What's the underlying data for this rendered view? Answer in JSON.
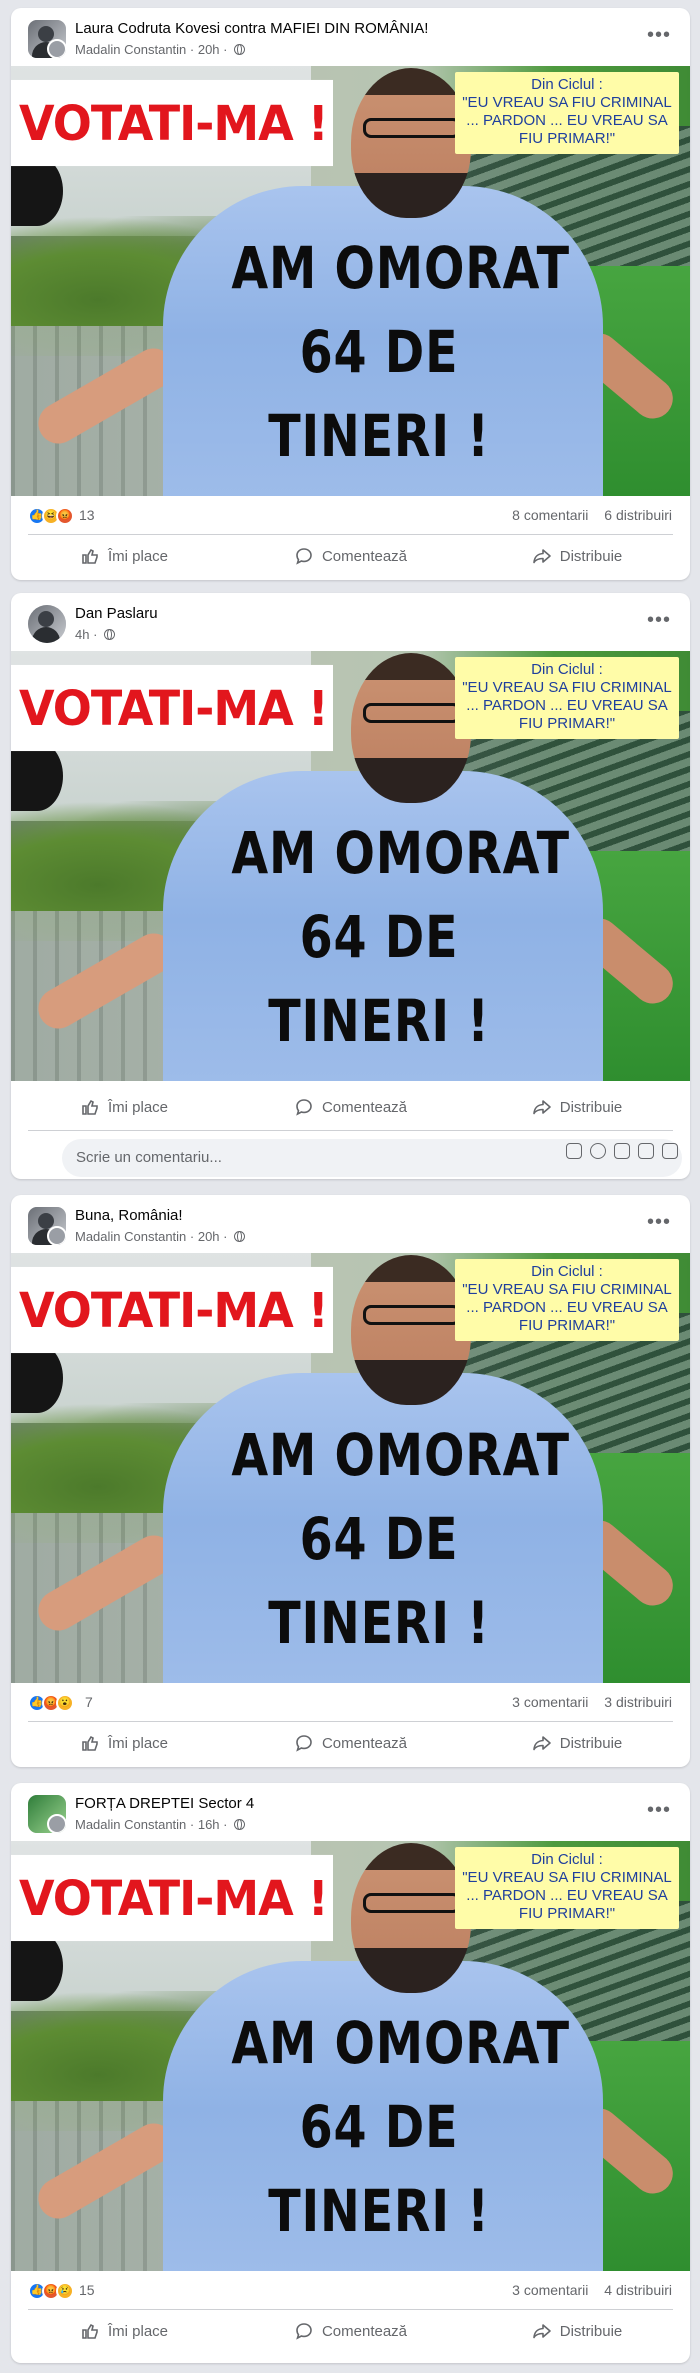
{
  "posts": [
    {
      "title": "Laura Codruta Kovesi contra MAFIEI DIN ROMÂNIA!",
      "meta": "Madalin Constantin · 20h ·",
      "image": {
        "banner": "VOTATI-MA !",
        "cycle_label": "Din Ciclul :",
        "cycle_text": "\"EU VREAU SA FIU CRIMINAL ... PARDON ... EU VREAU SA FIU PRIMAR!\"",
        "shirt_lines": [
          "AM OMORAT",
          "64 DE",
          "TINERI !"
        ]
      },
      "reactions_count": "13",
      "comments": "8 comentarii",
      "shares": "6 distribuiri"
    },
    {
      "title": "Dan Paslaru",
      "meta": "4h ·",
      "image": {
        "banner": "VOTATI-MA !",
        "cycle_label": "Din Ciclul :",
        "cycle_text": "\"EU VREAU SA FIU CRIMINAL ... PARDON ... EU VREAU SA FIU PRIMAR!\"",
        "shirt_lines": [
          "AM OMORAT",
          "64 DE",
          "TINERI !"
        ]
      },
      "comment_placeholder": "Scrie un comentariu..."
    },
    {
      "title": "Buna, România!",
      "meta": "Madalin Constantin · 20h ·",
      "image": {
        "banner": "VOTATI-MA !",
        "cycle_label": "Din Ciclul :",
        "cycle_text": "\"EU VREAU SA FIU CRIMINAL ... PARDON ... EU VREAU SA FIU PRIMAR!\"",
        "shirt_lines": [
          "AM OMORAT",
          "64 DE",
          "TINERI !"
        ]
      },
      "reactions_count": "7",
      "comments": "3 comentarii",
      "shares": "3 distribuiri"
    },
    {
      "title": "FORȚA DREPTEI Sector 4",
      "meta": "Madalin Constantin · 16h ·",
      "image": {
        "banner": "VOTATI-MA !",
        "cycle_label": "Din Ciclul :",
        "cycle_text": "\"EU VREAU SA FIU CRIMINAL ... PARDON ... EU VREAU SA FIU PRIMAR!\"",
        "shirt_lines": [
          "AM OMORAT",
          "64 DE",
          "TINERI !"
        ]
      },
      "reactions_count": "15",
      "comments": "3 comentarii",
      "shares": "4 distribuiri"
    }
  ],
  "actions": {
    "like": "Îmi place",
    "comment": "Comentează",
    "share": "Distribuie"
  },
  "icons": {
    "more": "more-horizontal-icon",
    "privacy": "globe-icon",
    "like": "thumbs-up-icon",
    "comment": "speech-bubble-icon",
    "share": "share-arrow-icon"
  },
  "colors": {
    "page_bg": "#e4e6eb",
    "card_bg": "#ffffff",
    "secondary_text": "#65676b",
    "like_blue": "#1877f2",
    "banner_red": "#e2161d",
    "cycle_bg": "#fffca8",
    "cycle_text": "#1f3f9d"
  }
}
